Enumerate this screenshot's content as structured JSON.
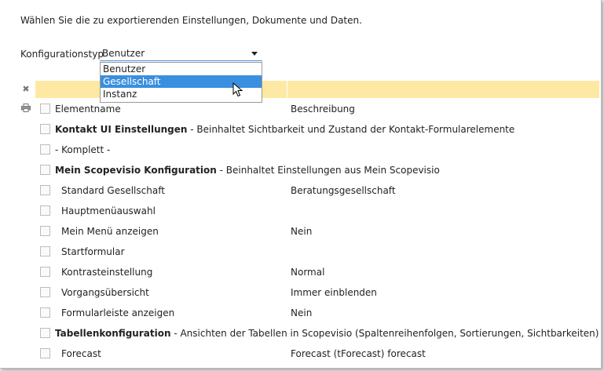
{
  "intro": "Wählen Sie die zu exportierenden Einstellungen, Dokumente und Daten.",
  "config": {
    "label": "Konfigurationstyp",
    "selected": "Benutzer",
    "options": [
      "Benutzer",
      "Gesellschaft",
      "Instanz"
    ],
    "highlighted": "Gesellschaft"
  },
  "table": {
    "col_name": "Elementname",
    "col_desc": "Beschreibung",
    "rows": [
      {
        "bold": "Kontakt UI Einstellungen",
        "rest": " - Beinhaltet Sichtbarkeit und Zustand der Kontakt-Formularelemente",
        "desc": ""
      },
      {
        "bold": "",
        "rest": "- Komplett -",
        "desc": ""
      },
      {
        "bold": "Mein Scopevisio Konfiguration",
        "rest": " - Beinhaltet Einstellungen aus Mein Scopevisio",
        "desc": ""
      },
      {
        "bold": "",
        "rest": "Standard Gesellschaft",
        "desc": "Beratungsgesellschaft",
        "sub": true
      },
      {
        "bold": "",
        "rest": "Hauptmenüauswahl",
        "desc": "",
        "sub": true
      },
      {
        "bold": "",
        "rest": "Mein Menü anzeigen",
        "desc": "Nein",
        "sub": true
      },
      {
        "bold": "",
        "rest": "Startformular",
        "desc": "",
        "sub": true
      },
      {
        "bold": "",
        "rest": "Kontrasteinstellung",
        "desc": "Normal",
        "sub": true
      },
      {
        "bold": "",
        "rest": "Vorgangsübersicht",
        "desc": "Immer einblenden",
        "sub": true
      },
      {
        "bold": "",
        "rest": "Formularleiste anzeigen",
        "desc": "Nein",
        "sub": true
      },
      {
        "bold": "Tabellenkonfiguration",
        "rest": " - Ansichten der Tabellen in Scopevisio (Spaltenreihenfolgen, Sortierungen, Sichtbarkeiten)",
        "desc": ""
      },
      {
        "bold": "",
        "rest": "Forecast",
        "desc": "Forecast (tForecast) forecast",
        "sub": true
      }
    ]
  },
  "icons": {
    "clear": "close-icon",
    "print": "printer-icon",
    "cursor": "mouse-pointer-icon"
  },
  "colors": {
    "filter_bg": "#fde9a3",
    "selection": "#3a8fde"
  }
}
